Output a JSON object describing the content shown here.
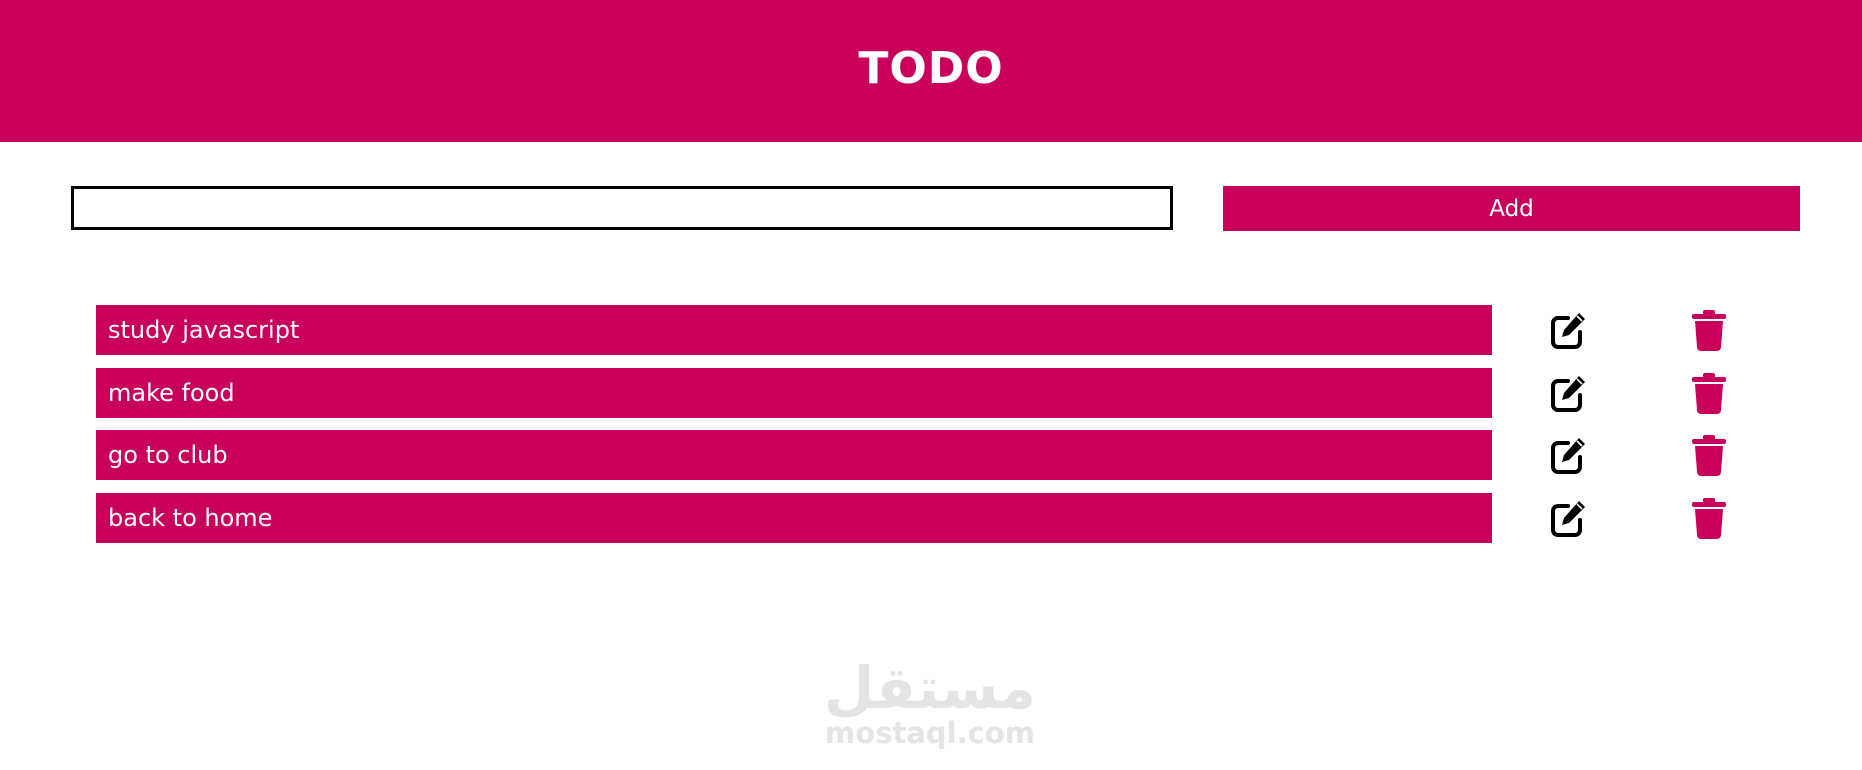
{
  "header": {
    "title": "TODO"
  },
  "form": {
    "input_value": "",
    "input_placeholder": "",
    "add_label": "Add"
  },
  "tasks": [
    {
      "text": "study javascript",
      "edit_icon": "edit-icon",
      "delete_icon": "trash-icon"
    },
    {
      "text": "make food",
      "edit_icon": "edit-icon",
      "delete_icon": "trash-icon"
    },
    {
      "text": "go to club",
      "edit_icon": "edit-icon",
      "delete_icon": "trash-icon"
    },
    {
      "text": "back to home",
      "edit_icon": "edit-icon",
      "delete_icon": "trash-icon"
    }
  ],
  "watermark": {
    "arabic": "مستقل",
    "latin": "mostaql.com"
  },
  "colors": {
    "accent": "#c8005c",
    "edit_icon": "#000000",
    "delete_icon": "#c8005c",
    "watermark": "#e4e4e4"
  }
}
